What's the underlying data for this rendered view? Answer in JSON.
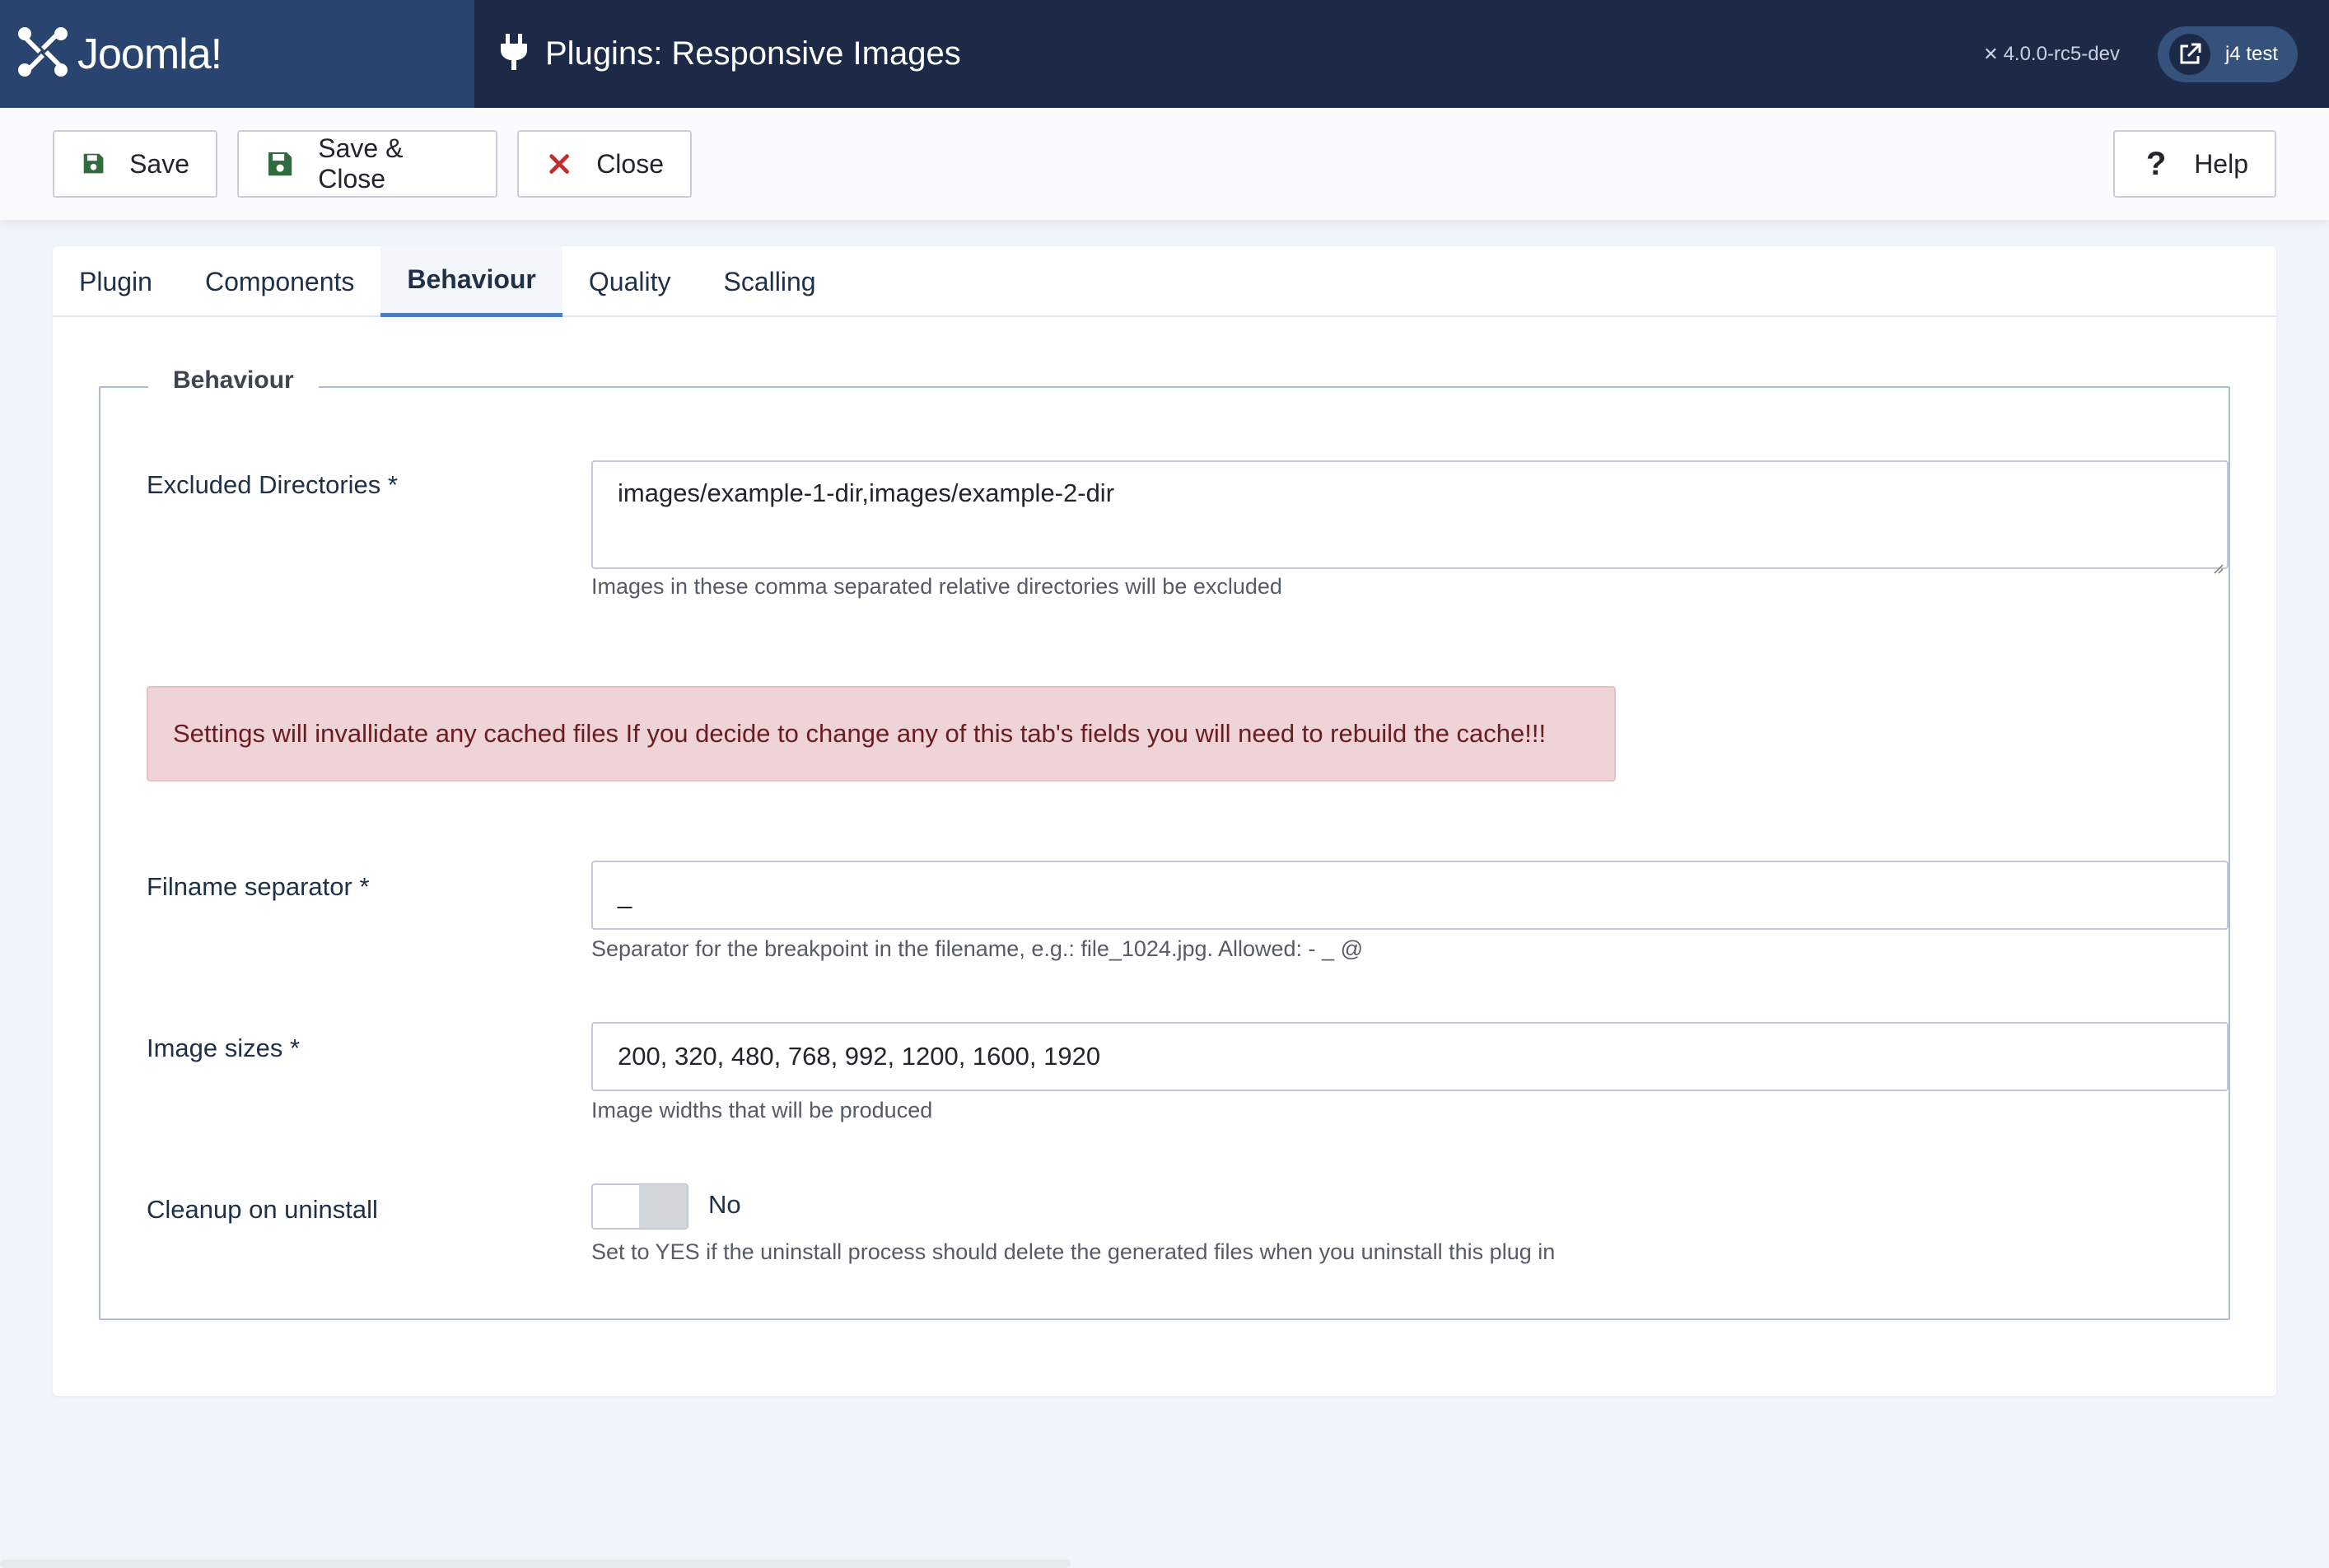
{
  "header": {
    "logo_text": "Joomla!",
    "page_title": "Plugins: Responsive Images",
    "version": "4.0.0-rc5-dev",
    "user": "j4 test"
  },
  "toolbar": {
    "save_label": "Save",
    "save_close_label": "Save & Close",
    "close_label": "Close",
    "help_label": "Help"
  },
  "tabs": [
    {
      "label": "Plugin"
    },
    {
      "label": "Components"
    },
    {
      "label": "Behaviour",
      "active": true
    },
    {
      "label": "Quality"
    },
    {
      "label": "Scalling"
    }
  ],
  "fieldset": {
    "legend": "Behaviour",
    "excluded_dirs": {
      "label": "Excluded Directories *",
      "value": "images/example-1-dir,images/example-2-dir",
      "help": "Images in these comma separated relative directories will be excluded"
    },
    "alert": "Settings will invallidate any cached files If you decide to change any of this tab's fields you will need to rebuild the cache!!!",
    "separator": {
      "label": "Filname separator *",
      "value": "_",
      "help": "Separator for the breakpoint in the filename, e.g.: file_1024.jpg. Allowed: - _ @"
    },
    "image_sizes": {
      "label": "Image sizes *",
      "value": "200, 320, 480, 768, 992, 1200, 1600, 1920",
      "help": "Image widths that will be produced"
    },
    "cleanup": {
      "label": "Cleanup on uninstall",
      "value": "No",
      "help": "Set to YES if the uninstall process should delete the generated files when you uninstall this plug in"
    }
  },
  "colors": {
    "header_bg": "#1c2a48",
    "logo_bg": "#2a4470",
    "save_icon": "#2f6b3c",
    "close_icon": "#c12d2d",
    "alert_bg": "#eed4d6",
    "tab_accent": "#4c7ec4"
  }
}
